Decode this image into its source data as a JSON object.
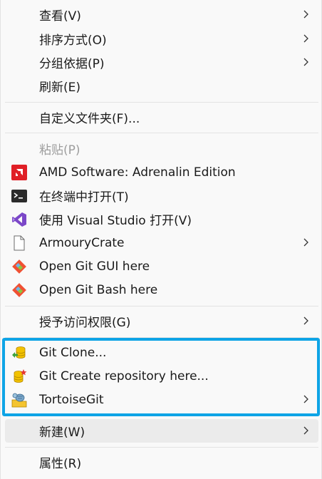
{
  "menu": {
    "view": {
      "label": "查看(V)"
    },
    "sort_by": {
      "label": "排序方式(O)"
    },
    "group_by": {
      "label": "分组依据(P)"
    },
    "refresh": {
      "label": "刷新(E)"
    },
    "customize_folder": {
      "label": "自定义文件夹(F)..."
    },
    "paste": {
      "label": "粘贴(P)"
    },
    "amd_software": {
      "label": "AMD Software: Adrenalin Edition",
      "icon": "amd-icon"
    },
    "open_terminal": {
      "label": "在终端中打开(T)",
      "icon": "terminal-icon"
    },
    "open_visual_studio": {
      "label": "使用 Visual Studio 打开(V)",
      "icon": "visual-studio-icon"
    },
    "armoury_crate": {
      "label": "ArmouryCrate",
      "icon": "file-icon"
    },
    "git_gui": {
      "label": "Open Git GUI here",
      "icon": "git-icon"
    },
    "git_bash": {
      "label": "Open Git Bash here",
      "icon": "git-icon"
    },
    "grant_access": {
      "label": "授予访问权限(G)"
    },
    "git_clone": {
      "label": "Git Clone...",
      "icon": "git-clone-icon"
    },
    "git_create_repo": {
      "label": "Git Create repository here...",
      "icon": "git-create-repo-icon"
    },
    "tortoise_git": {
      "label": "TortoiseGit",
      "icon": "tortoisegit-icon"
    },
    "new": {
      "label": "新建(W)"
    },
    "properties": {
      "label": "属性(R)"
    }
  },
  "colors": {
    "highlight_border": "#0ea4e6",
    "amd_red": "#e01f26",
    "vs_purple": "#7b47c8",
    "git_orange": "#f05133"
  }
}
